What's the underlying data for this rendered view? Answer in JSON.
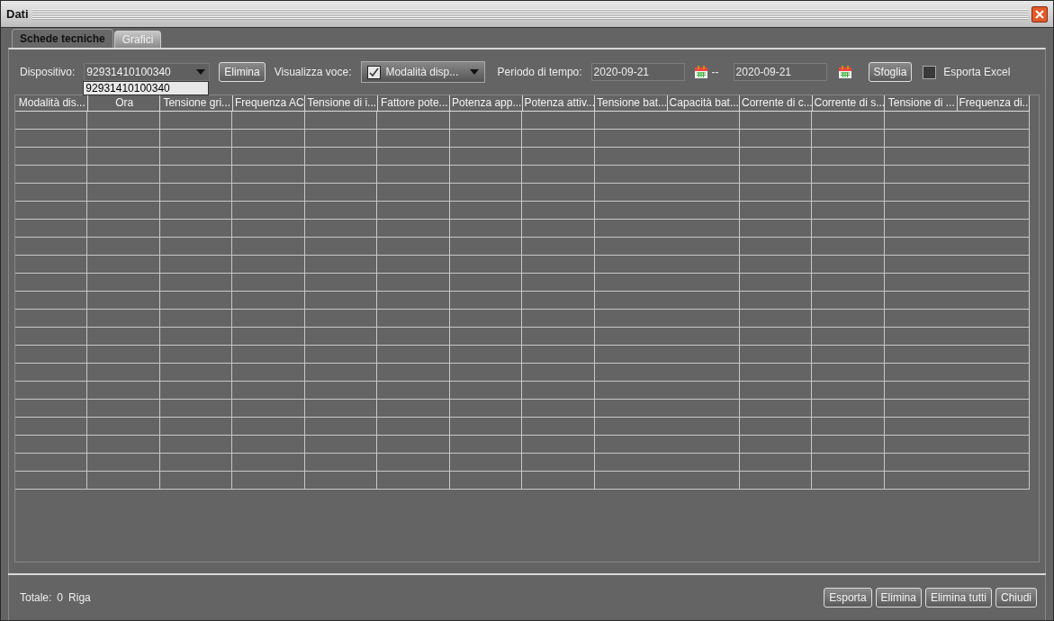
{
  "window": {
    "title": "Dati"
  },
  "tabs": [
    {
      "label": "Schede tecniche",
      "selected": true
    },
    {
      "label": "Grafici",
      "selected": false
    }
  ],
  "toolbar": {
    "device_label": "Dispositivo:",
    "device_value": "92931410100340",
    "device_popup_item": "92931410100340",
    "delete_button": "Elimina",
    "view_label": "Visualizza voce:",
    "view_checked": true,
    "view_value": "Modalità disp...",
    "period_label": "Periodo di tempo:",
    "date_from": "2020-09-21",
    "date_separator": "--",
    "date_to": "2020-09-21",
    "browse_button": "Sfoglia",
    "export_excel_label": "Esporta Excel",
    "export_excel_checked": false
  },
  "table": {
    "columns": [
      "Modalità dis...",
      "Ora",
      "Tensione gri...",
      "Frequenza AC",
      "Tensione di i...",
      "Fattore pote...",
      "Potenza app...",
      "Potenza attiv...",
      "Tensione bat...",
      "Capacità bat...",
      "Corrente di c...",
      "Corrente di s...",
      "Tensione di ...",
      "Frequenza di..."
    ]
  },
  "status_bar": {
    "total_label": "Totale:",
    "total_count": "0",
    "unit": "Riga",
    "buttons": [
      "Esporta",
      "Elimina",
      "Elimina tutti",
      "Chiudi"
    ]
  }
}
